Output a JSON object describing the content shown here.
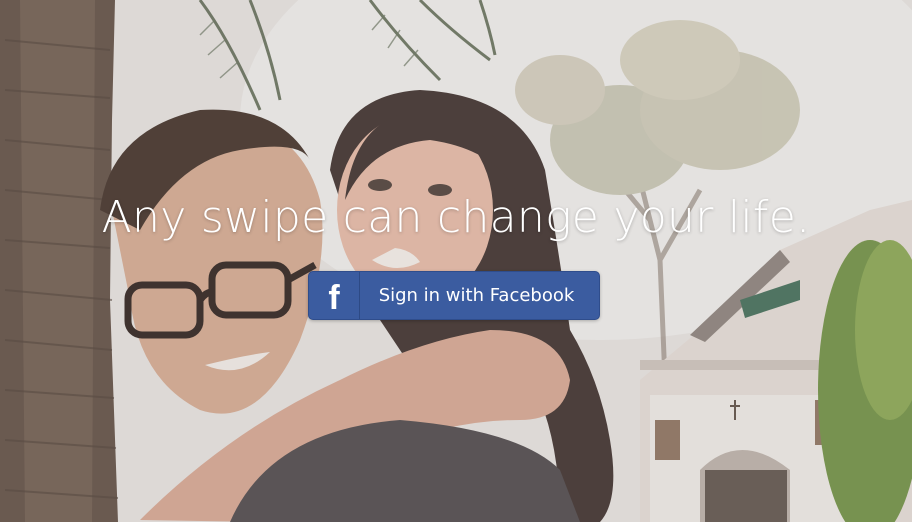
{
  "hero": {
    "headline": "Any swipe can change your life.",
    "background": "photo-couple-piggyback"
  },
  "facebook_button": {
    "label": "Sign in with Facebook",
    "icon": "facebook-f-icon",
    "icon_glyph": "f",
    "color": "#3b5ca0"
  }
}
